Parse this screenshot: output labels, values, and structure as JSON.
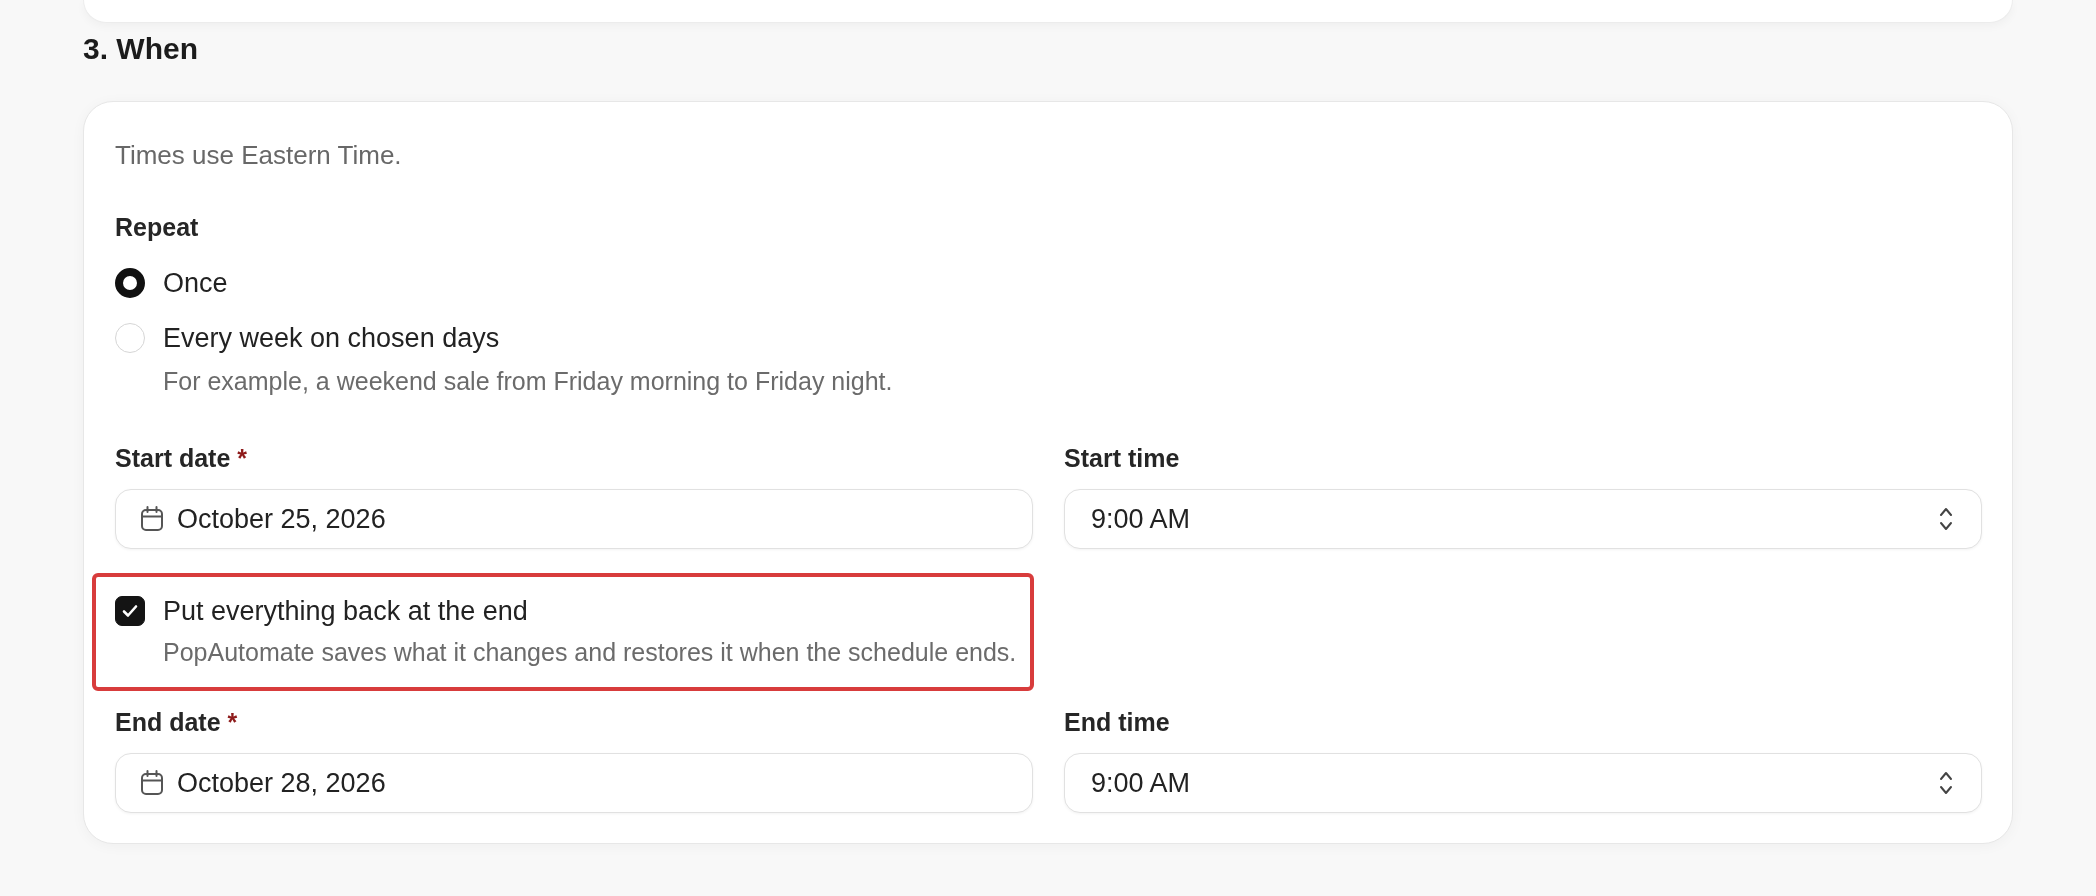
{
  "section": {
    "title": "3. When",
    "note": "Times use Eastern Time.",
    "repeat": {
      "label": "Repeat",
      "options": [
        {
          "label": "Once",
          "selected": true
        },
        {
          "label": "Every week on chosen days",
          "selected": false,
          "hint": "For example, a weekend sale from Friday morning to Friday night."
        }
      ]
    },
    "start": {
      "date": {
        "label": "Start date",
        "required_mark": "*",
        "value": "October 25, 2026"
      },
      "time": {
        "label": "Start time",
        "value": "9:00 AM"
      }
    },
    "restore": {
      "label": "Put everything back at the end",
      "checked": true,
      "highlighted": true,
      "description": "PopAutomate saves what it changes and restores it when the schedule ends."
    },
    "end": {
      "date": {
        "label": "End date",
        "required_mark": "*",
        "value": "October 28, 2026"
      },
      "time": {
        "label": "End time",
        "value": "9:00 AM"
      }
    }
  }
}
